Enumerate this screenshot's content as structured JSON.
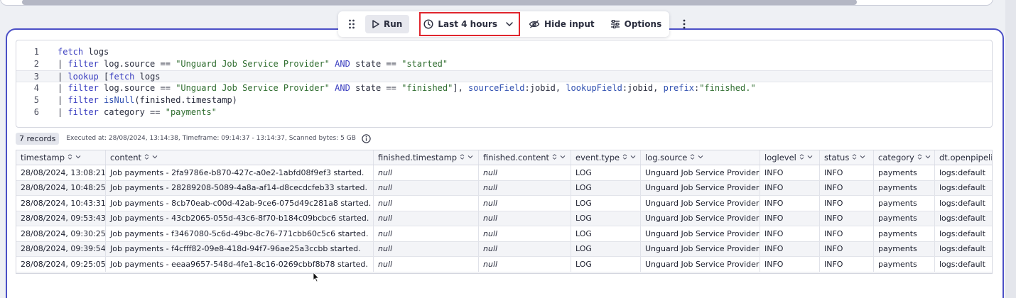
{
  "toolbar": {
    "drag_icon": "drag-handle-icon",
    "run_label": "Run",
    "time_label": "Last 4 hours",
    "hide_input_label": "Hide input",
    "options_label": "Options"
  },
  "editor": {
    "lines": [
      {
        "n": "1",
        "text": "fetch logs"
      },
      {
        "n": "2",
        "text": "| filter log.source == \"Unguard Job Service Provider\" AND state == \"started\""
      },
      {
        "n": "3",
        "text": "| lookup [fetch logs"
      },
      {
        "n": "4",
        "text": "| filter log.source == \"Unguard Job Service Provider\" AND state == \"finished\"], sourceField:jobid, lookupField:jobid, prefix:\"finished.\""
      },
      {
        "n": "5",
        "text": "| filter isNull(finished.timestamp)"
      },
      {
        "n": "6",
        "text": "| filter category == \"payments\""
      }
    ]
  },
  "result": {
    "records": "7 records",
    "meta": "Executed at: 28/08/2024, 13:14:38, Timeframe: 09:14:37 - 13:14:37, Scanned bytes: 5 GB"
  },
  "table": {
    "columns": [
      "timestamp",
      "content",
      "finished.timestamp",
      "finished.content",
      "event.type",
      "log.source",
      "loglevel",
      "status",
      "category",
      "dt.openpipeli"
    ],
    "rows": [
      [
        "28/08/2024, 13:08:21",
        "Job payments - 2fa9786e-b870-427c-a0e2-1abfd08f9ef3 started.",
        "null",
        "null",
        "LOG",
        "Unguard Job Service Provider",
        "INFO",
        "INFO",
        "payments",
        "logs:default"
      ],
      [
        "28/08/2024, 10:48:25",
        "Job payments - 28289208-5089-4a8a-af14-d8cecdcfeb33 started.",
        "null",
        "null",
        "LOG",
        "Unguard Job Service Provider",
        "INFO",
        "INFO",
        "payments",
        "logs:default"
      ],
      [
        "28/08/2024, 10:43:31",
        "Job payments - 8cb70eab-c00d-42ab-9ce6-075d49c281a8 started.",
        "null",
        "null",
        "LOG",
        "Unguard Job Service Provider",
        "INFO",
        "INFO",
        "payments",
        "logs:default"
      ],
      [
        "28/08/2024, 09:53:43",
        "Job payments - 43cb2065-055d-43c6-8f70-b184c09bcbc6 started.",
        "null",
        "null",
        "LOG",
        "Unguard Job Service Provider",
        "INFO",
        "INFO",
        "payments",
        "logs:default"
      ],
      [
        "28/08/2024, 09:30:25",
        "Job payments - f3467080-5c6d-49bc-8c76-771cbb60c5c6 started.",
        "null",
        "null",
        "LOG",
        "Unguard Job Service Provider",
        "INFO",
        "INFO",
        "payments",
        "logs:default"
      ],
      [
        "28/08/2024, 09:39:54",
        "Job payments - f4cfff82-09e8-418d-94f7-96ae25a3ccbb started.",
        "null",
        "null",
        "LOG",
        "Unguard Job Service Provider",
        "INFO",
        "INFO",
        "payments",
        "logs:default"
      ],
      [
        "28/08/2024, 09:25:05",
        "Job payments - eeaa9657-548d-4fe1-8c16-0269cbbf8b78 started.",
        "null",
        "null",
        "LOG",
        "Unguard Job Service Provider",
        "INFO",
        "INFO",
        "payments",
        "logs:default"
      ]
    ]
  },
  "colors": {
    "accent": "#4b4fc6",
    "highlight_box": "#e0252d"
  }
}
